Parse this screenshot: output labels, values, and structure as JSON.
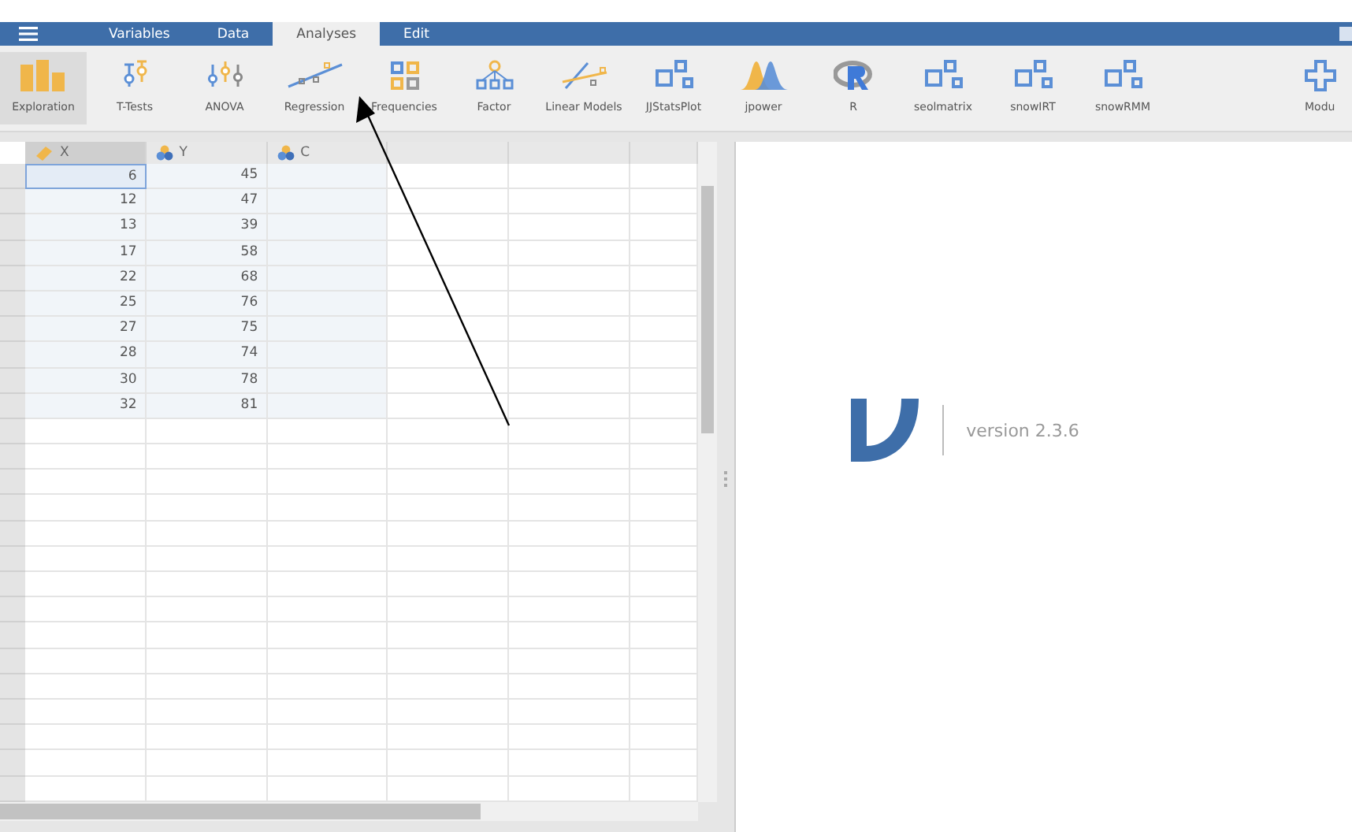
{
  "menu": {
    "tabs": [
      {
        "label": "Variables",
        "selected": false
      },
      {
        "label": "Data",
        "selected": false
      },
      {
        "label": "Analyses",
        "selected": true
      },
      {
        "label": "Edit",
        "selected": false
      }
    ]
  },
  "ribbon": {
    "items": [
      {
        "label": "Exploration",
        "selected": true
      },
      {
        "label": "T-Tests",
        "selected": false
      },
      {
        "label": "ANOVA",
        "selected": false
      },
      {
        "label": "Regression",
        "selected": false
      },
      {
        "label": "Frequencies",
        "selected": false
      },
      {
        "label": "Factor",
        "selected": false
      },
      {
        "label": "Linear Models",
        "selected": false
      },
      {
        "label": "JJStatsPlot",
        "selected": false
      },
      {
        "label": "jpower",
        "selected": false
      },
      {
        "label": "R",
        "selected": false
      },
      {
        "label": "seolmatrix",
        "selected": false
      },
      {
        "label": "snowIRT",
        "selected": false
      },
      {
        "label": "snowRMM",
        "selected": false
      },
      {
        "label": "Modu",
        "selected": false
      }
    ]
  },
  "spreadsheet": {
    "columns": [
      {
        "name": "X",
        "kind": "continuous",
        "selected": true
      },
      {
        "name": "Y",
        "kind": "nominal",
        "selected": false
      },
      {
        "name": "C",
        "kind": "nominal",
        "selected": false
      }
    ],
    "rows": [
      [
        "6",
        "45"
      ],
      [
        "12",
        "47"
      ],
      [
        "13",
        "39"
      ],
      [
        "17",
        "58"
      ],
      [
        "22",
        "68"
      ],
      [
        "25",
        "76"
      ],
      [
        "27",
        "75"
      ],
      [
        "28",
        "74"
      ],
      [
        "30",
        "78"
      ],
      [
        "32",
        "81"
      ]
    ]
  },
  "results": {
    "version": "version 2.3.6"
  }
}
